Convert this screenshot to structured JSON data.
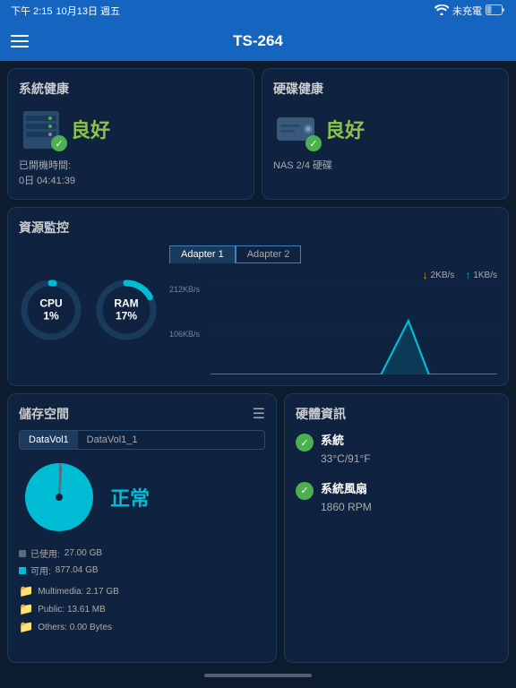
{
  "statusBar": {
    "time": "下午 2:15",
    "date": "10月13日 週五",
    "wifi": "wifi",
    "battery": "未充電"
  },
  "nav": {
    "title": "TS-264",
    "menu": "menu"
  },
  "systemHealth": {
    "title": "系統健康",
    "status": "良好",
    "uptime_label": "已開機時間:",
    "uptime": "0日 04:41:39"
  },
  "hddHealth": {
    "title": "硬碟健康",
    "status": "良好",
    "drives": "NAS 2/4 硬碟"
  },
  "resource": {
    "title": "資源監控",
    "cpu_label": "CPU",
    "cpu_value": "1%",
    "ram_label": "RAM",
    "ram_value": "17%",
    "adapter1": "Adapter 1",
    "adapter2": "Adapter 2",
    "download": "2KB/s",
    "upload": "1KB/s",
    "y_top": "212KB/s",
    "y_mid": "106KB/s"
  },
  "storage": {
    "title": "儲存空間",
    "tab1": "DataVol1",
    "tab2": "DataVol1_1",
    "status": "正常",
    "used_label": "已使用:",
    "used_val": "27.00 GB",
    "avail_label": "可用:",
    "avail_val": "877.04 GB",
    "folders": [
      {
        "name": "Multimedia:",
        "size": "2.17 GB"
      },
      {
        "name": "Public:",
        "size": "13.61 MB"
      },
      {
        "name": "Others:",
        "size": "0.00 Bytes"
      }
    ]
  },
  "hardware": {
    "title": "硬體資訊",
    "temp_label": "系統",
    "temp_val": "33°C/91°F",
    "fan_label": "系統風扇",
    "fan_val": "1860 RPM"
  },
  "colors": {
    "accent_blue": "#1565c0",
    "good_green": "#8bc34a",
    "cyan": "#00bcd4",
    "card_bg": "#0f2340"
  }
}
